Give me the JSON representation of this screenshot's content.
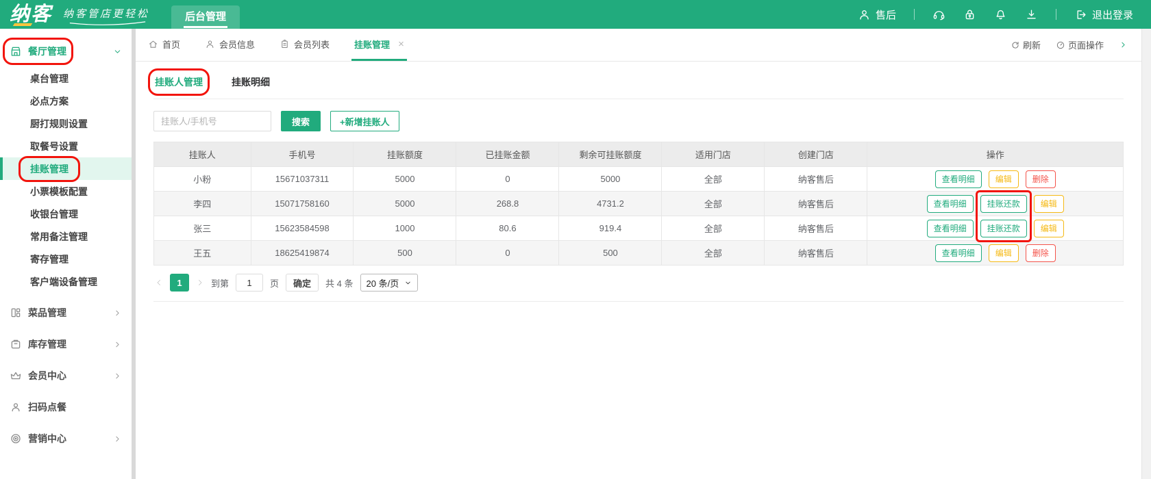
{
  "colors": {
    "primary": "#21ab7d",
    "primary-light": "#4abc97",
    "warning": "#f5b914",
    "danger": "#f4534a",
    "annotation": "#f2140c"
  },
  "header": {
    "logo_text": "纳客",
    "tagline": "纳客管店更轻松",
    "nav_tab": "后台管理",
    "user_label": "售后",
    "logout_label": "退出登录",
    "action_icons": [
      "headset-icon",
      "lock-icon",
      "bell-icon",
      "download-icon"
    ]
  },
  "tabbar": {
    "tabs": [
      {
        "label": "首页",
        "icon": "home-icon"
      },
      {
        "label": "会员信息",
        "icon": "user-icon"
      },
      {
        "label": "会员列表",
        "icon": "list-icon"
      },
      {
        "label": "挂账管理",
        "active": true,
        "closable": true
      }
    ],
    "refresh_label": "刷新",
    "page_actions_label": "页面操作"
  },
  "sidebar": {
    "groups": [
      {
        "label": "餐厅管理",
        "icon": "store-icon",
        "expanded": true,
        "annotated": true,
        "children": [
          {
            "label": "桌台管理"
          },
          {
            "label": "必点方案"
          },
          {
            "label": "厨打规则设置"
          },
          {
            "label": "取餐号设置"
          },
          {
            "label": "挂账管理",
            "active": true,
            "annotated": true
          },
          {
            "label": "小票模板配置"
          },
          {
            "label": "收银台管理"
          },
          {
            "label": "常用备注管理"
          },
          {
            "label": "寄存管理"
          },
          {
            "label": "客户端设备管理"
          }
        ]
      },
      {
        "label": "菜品管理",
        "icon": "dishes-icon",
        "arrow": true
      },
      {
        "label": "库存管理",
        "icon": "inventory-icon",
        "arrow": true
      },
      {
        "label": "会员中心",
        "icon": "member-icon",
        "arrow": true
      },
      {
        "label": "扫码点餐",
        "icon": "scan-order-icon",
        "arrow": false
      },
      {
        "label": "营销中心",
        "icon": "marketing-icon",
        "arrow": true
      }
    ]
  },
  "content": {
    "subtabs": [
      {
        "label": "挂账人管理",
        "active": true,
        "annotated": true
      },
      {
        "label": "挂账明细"
      }
    ],
    "search": {
      "placeholder": "挂账人/手机号",
      "search_button": "搜索",
      "add_button": "+新增挂账人"
    },
    "table": {
      "headers": [
        "挂账人",
        "手机号",
        "挂账额度",
        "已挂账金额",
        "剩余可挂账额度",
        "适用门店",
        "创建门店",
        "操作"
      ],
      "rows": [
        {
          "cells": [
            "小粉",
            "15671037311",
            "5000",
            "0",
            "5000",
            "全部",
            "纳客售后"
          ],
          "actions": [
            {
              "label": "查看明细",
              "style": "green"
            },
            {
              "label": "编辑",
              "style": "yellow"
            },
            {
              "label": "删除",
              "style": "red"
            }
          ]
        },
        {
          "cells": [
            "李四",
            "15071758160",
            "5000",
            "268.8",
            "4731.2",
            "全部",
            "纳客售后"
          ],
          "actions": [
            {
              "label": "查看明细",
              "style": "green"
            },
            {
              "label": "挂账还款",
              "style": "green",
              "annotate": true
            },
            {
              "label": "编辑",
              "style": "yellow"
            }
          ]
        },
        {
          "cells": [
            "张三",
            "15623584598",
            "1000",
            "80.6",
            "919.4",
            "全部",
            "纳客售后"
          ],
          "actions": [
            {
              "label": "查看明细",
              "style": "green"
            },
            {
              "label": "挂账还款",
              "style": "green",
              "annotate": true
            },
            {
              "label": "编辑",
              "style": "yellow"
            }
          ]
        },
        {
          "cells": [
            "王五",
            "18625419874",
            "500",
            "0",
            "500",
            "全部",
            "纳客售后"
          ],
          "actions": [
            {
              "label": "查看明细",
              "style": "green"
            },
            {
              "label": "编辑",
              "style": "yellow"
            },
            {
              "label": "删除",
              "style": "red"
            }
          ]
        }
      ]
    },
    "pagination": {
      "current_page": "1",
      "goto_label": "到第",
      "goto_value": "1",
      "unit_label": "页",
      "confirm_button": "确定",
      "total_label": "共 4 条",
      "page_size": "20 条/页"
    }
  }
}
